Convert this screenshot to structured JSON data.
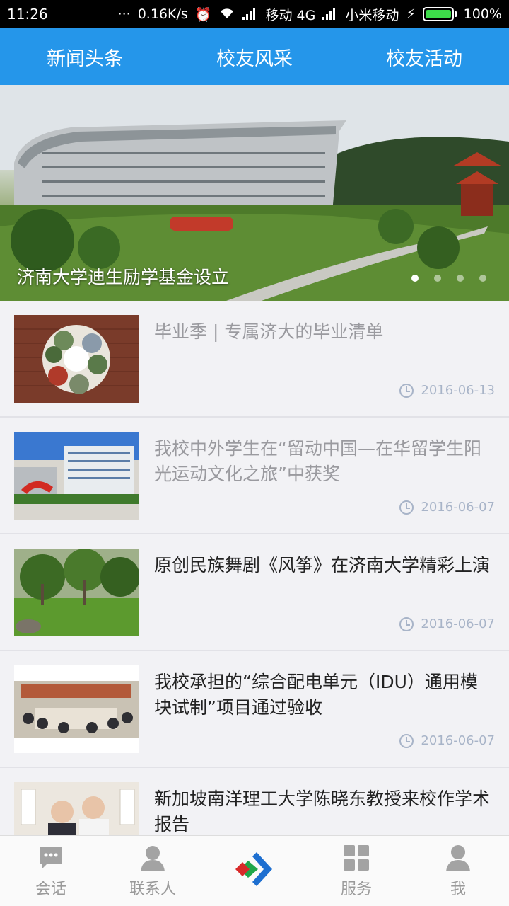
{
  "status_bar": {
    "time": "11:26",
    "dots": "···",
    "speed": "0.16K/s",
    "carrier1": "移动 4G",
    "carrier2": "小米移动",
    "battery": "100%"
  },
  "top_nav": {
    "tabs": [
      "新闻头条",
      "校友风采",
      "校友活动"
    ]
  },
  "banner": {
    "caption": "济南大学迪生励学基金设立",
    "page_count": 4,
    "active_page": 1
  },
  "news": [
    {
      "title": "毕业季 | 专属济大的毕业清单",
      "date": "2016-06-13",
      "read": true
    },
    {
      "title": "我校中外学生在“留动中国—在华留学生阳光运动文化之旅”中获奖",
      "date": "2016-06-07",
      "read": true
    },
    {
      "title": "原创民族舞剧《风筝》在济南大学精彩上演",
      "date": "2016-06-07",
      "read": false
    },
    {
      "title": "我校承担的“综合配电单元（IDU）通用模块试制”项目通过验收",
      "date": "2016-06-07",
      "read": false
    },
    {
      "title": "新加坡南洋理工大学陈晓东教授来校作学术报告",
      "date": "",
      "read": false
    }
  ],
  "bottom_nav": {
    "items": [
      {
        "label": "会话",
        "icon": "chat-icon"
      },
      {
        "label": "联系人",
        "icon": "contacts-icon"
      },
      {
        "label": "",
        "icon": "app-logo-icon"
      },
      {
        "label": "服务",
        "icon": "grid-icon"
      },
      {
        "label": "我",
        "icon": "person-icon"
      }
    ]
  },
  "colors": {
    "accent": "#2596ea",
    "read_title": "#9a9a9f",
    "date": "#a8b4c8"
  }
}
